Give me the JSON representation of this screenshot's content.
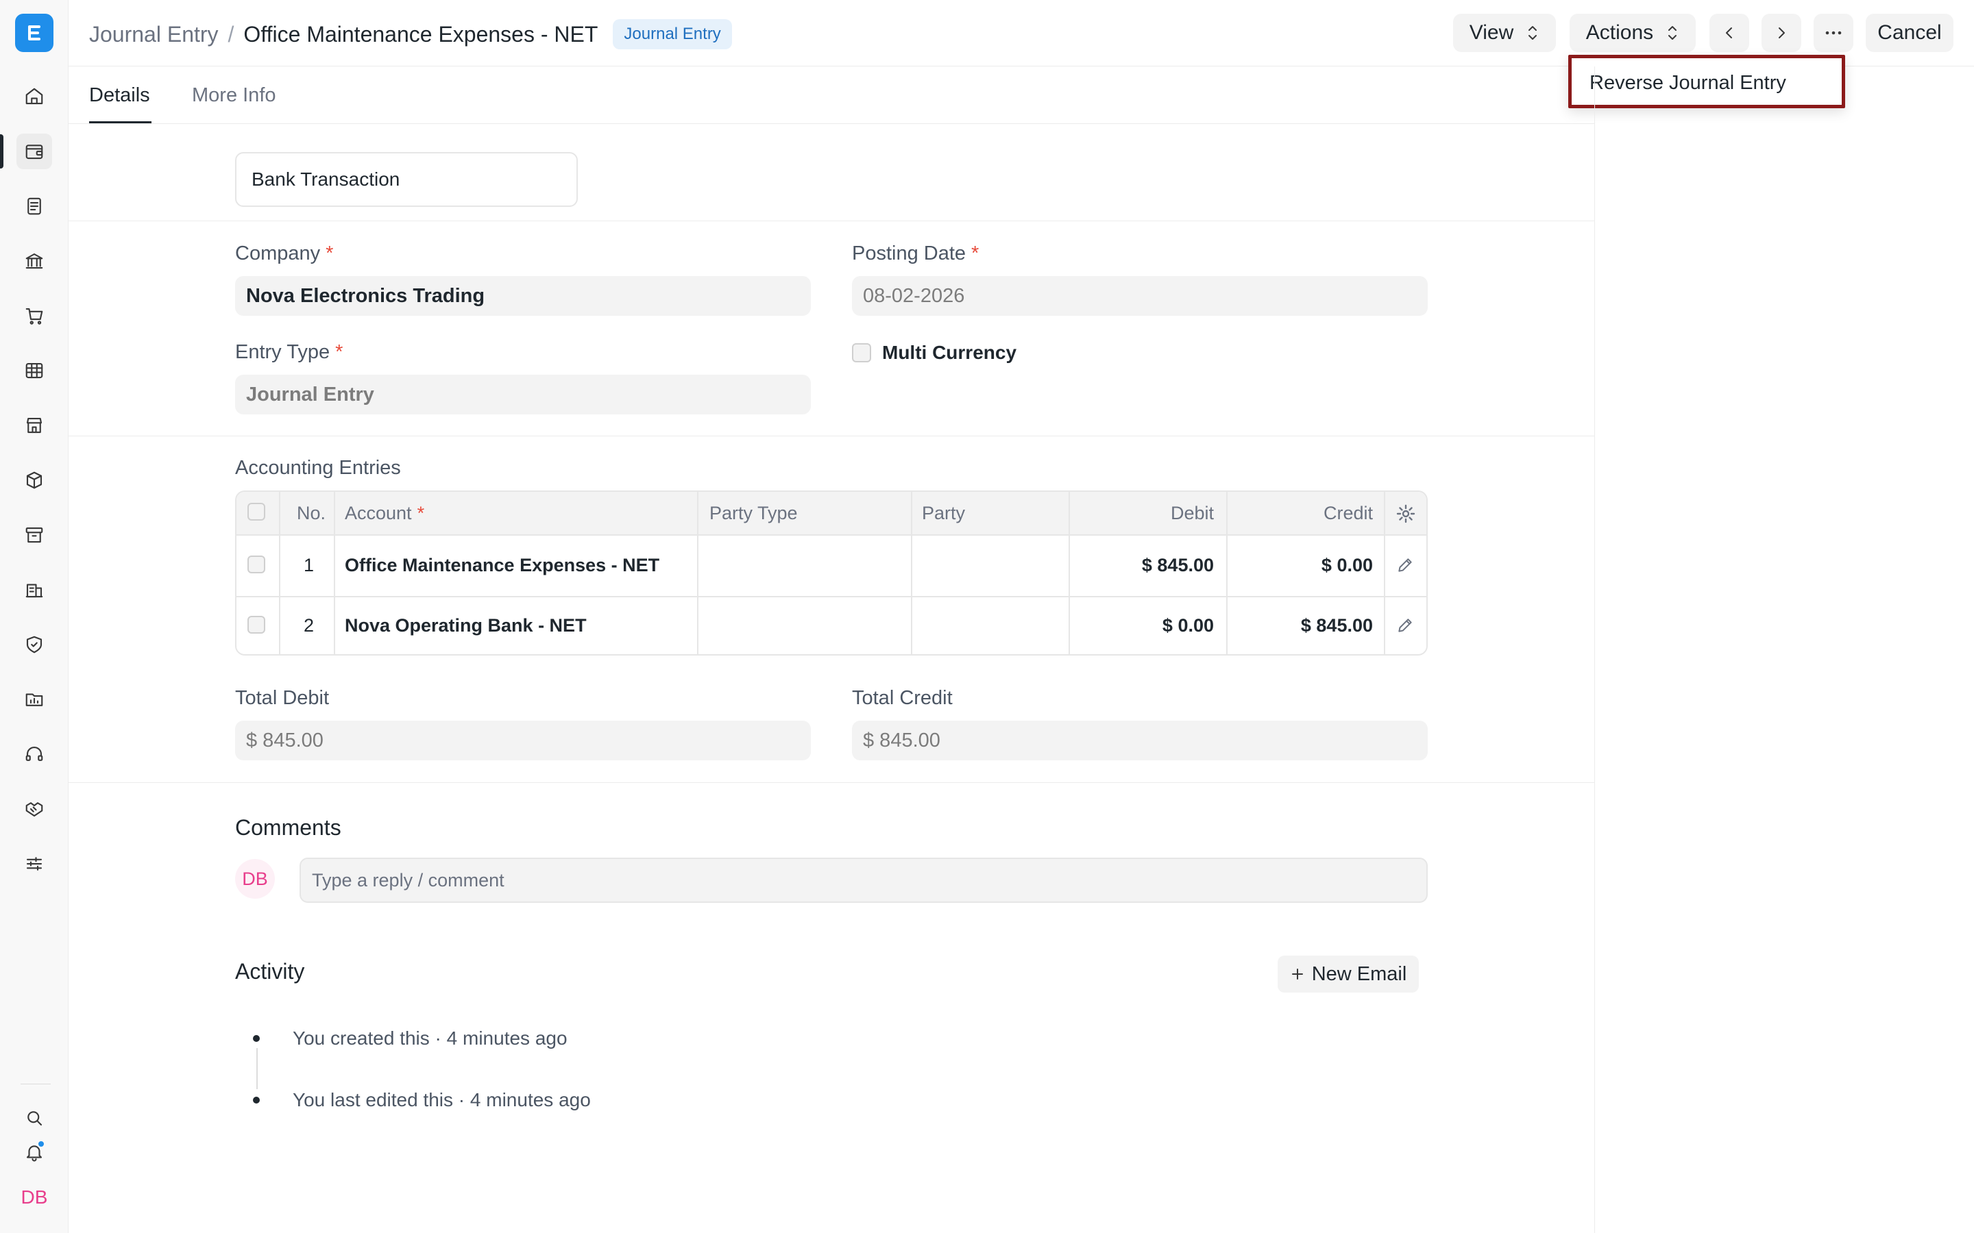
{
  "header": {
    "breadcrumb_parent": "Journal Entry",
    "breadcrumb_sep": "/",
    "title": "Office Maintenance Expenses - NET",
    "badge": "Journal Entry",
    "view_label": "View",
    "actions_label": "Actions",
    "more_label": "···",
    "cancel_label": "Cancel"
  },
  "dropdown": {
    "items": [
      "Reverse Journal Entry"
    ]
  },
  "tabs": [
    "Details",
    "More Info"
  ],
  "form": {
    "voucher_type_value": "Bank Transaction",
    "company_label": "Company",
    "company_value": "Nova Electronics Trading",
    "posting_date_label": "Posting Date",
    "posting_date_value": "08-02-2026",
    "entry_type_label": "Entry Type",
    "entry_type_value": "Journal Entry",
    "multi_currency_label": "Multi Currency",
    "required_mark": "*"
  },
  "accounts": {
    "title": "Accounting Entries",
    "columns": [
      "No.",
      "Account",
      "Party Type",
      "Party",
      "Debit",
      "Credit"
    ],
    "rows": [
      {
        "no": "1",
        "account": "Office Maintenance Expenses - NET",
        "party_type": "",
        "party": "",
        "debit": "$ 845.00",
        "credit": "$ 0.00"
      },
      {
        "no": "2",
        "account": "Nova Operating Bank - NET",
        "party_type": "",
        "party": "",
        "debit": "$ 0.00",
        "credit": "$ 845.00"
      }
    ]
  },
  "totals": {
    "debit_label": "Total Debit",
    "debit_value": "$ 845.00",
    "credit_label": "Total Credit",
    "credit_value": "$ 845.00"
  },
  "comments": {
    "title": "Comments",
    "avatar": "DB",
    "placeholder": "Type a reply / comment"
  },
  "activity": {
    "title": "Activity",
    "new_email_label": "New Email",
    "items": [
      "You created this · 4 minutes ago",
      "You last edited this · 4 minutes ago"
    ]
  },
  "sidebar": {
    "user_initials": "DB",
    "icons": [
      "home-icon",
      "wallet-icon",
      "document-icon",
      "bank-icon",
      "cart-icon",
      "table-icon",
      "store-icon",
      "box-icon",
      "archive-icon",
      "building-icon",
      "shield-icon",
      "folder-icon",
      "headset-icon",
      "handshake-icon",
      "sliders-icon",
      "search-icon",
      "bell-icon"
    ]
  },
  "colors": {
    "accent": "#1f8eea",
    "highlight_border": "#8b1a1a",
    "required": "#e74c3c",
    "avatar": "#e83e8c"
  }
}
